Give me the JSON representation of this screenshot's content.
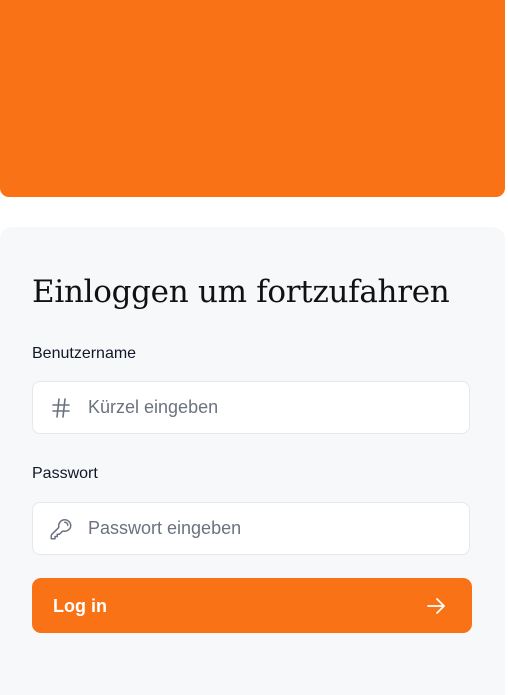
{
  "login": {
    "title": "Einloggen um fortzufahren",
    "username": {
      "label": "Benutzername",
      "placeholder": "Kürzel eingeben",
      "value": "",
      "icon": "hash-icon"
    },
    "password": {
      "label": "Passwort",
      "placeholder": "Passwort eingeben",
      "value": "",
      "icon": "key-icon"
    },
    "submit": {
      "label": "Log in",
      "icon": "arrow-right-icon"
    }
  },
  "colors": {
    "accent": "#f97316",
    "card_background": "#f7f8fa",
    "text": "#111827",
    "placeholder": "#6b7280",
    "border": "#e5e7eb"
  }
}
